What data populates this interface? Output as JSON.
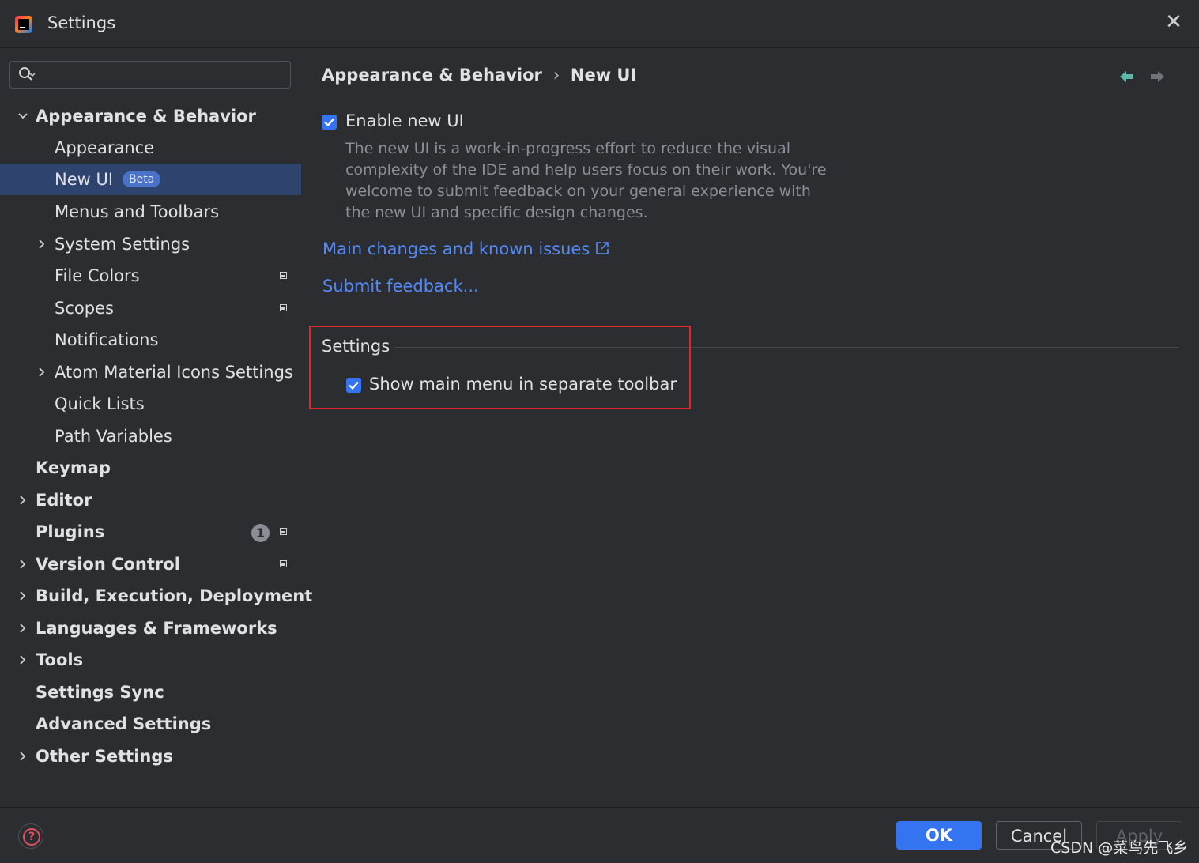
{
  "window": {
    "title": "Settings"
  },
  "search": {
    "placeholder": "",
    "value": ""
  },
  "sidebar": {
    "items": [
      {
        "label": "Appearance & Behavior"
      },
      {
        "label": "Appearance"
      },
      {
        "label": "New UI",
        "badge": "Beta"
      },
      {
        "label": "Menus and Toolbars"
      },
      {
        "label": "System Settings"
      },
      {
        "label": "File Colors"
      },
      {
        "label": "Scopes"
      },
      {
        "label": "Notifications"
      },
      {
        "label": "Atom Material Icons Settings"
      },
      {
        "label": "Quick Lists"
      },
      {
        "label": "Path Variables"
      },
      {
        "label": "Keymap"
      },
      {
        "label": "Editor"
      },
      {
        "label": "Plugins",
        "count": "1"
      },
      {
        "label": "Version Control"
      },
      {
        "label": "Build, Execution, Deployment"
      },
      {
        "label": "Languages & Frameworks"
      },
      {
        "label": "Tools"
      },
      {
        "label": "Settings Sync"
      },
      {
        "label": "Advanced Settings"
      },
      {
        "label": "Other Settings"
      }
    ]
  },
  "content": {
    "breadcrumb": [
      "Appearance & Behavior",
      "New UI"
    ],
    "breadcrumb_separator": "›",
    "enable_new_ui": {
      "label": "Enable new UI",
      "checked": true,
      "description": "The new UI is a work-in-progress effort to reduce the visual complexity of the IDE and help users focus on their work. You're welcome to submit feedback on your general experience with the new UI and specific design changes."
    },
    "link_changes": "Main changes and known issues",
    "link_feedback": "Submit feedback...",
    "settings_section": {
      "title": "Settings",
      "show_main_menu": {
        "label": "Show main menu in separate toolbar",
        "checked": true
      }
    }
  },
  "footer": {
    "ok": "OK",
    "cancel": "Cancel",
    "apply": "Apply",
    "watermark": "CSDN @菜鸟先飞乡"
  },
  "colors": {
    "background": "#2b2d30",
    "selection": "#2e436e",
    "accent": "#3574f0",
    "link": "#548af7",
    "highlight_border": "#e3262c"
  },
  "icons": [
    "app-logo-icon",
    "close-icon",
    "search-icon",
    "chevron-down-icon",
    "chevron-right-icon",
    "project-level-icon",
    "back-arrow-icon",
    "forward-arrow-icon",
    "external-link-icon",
    "checkmark-icon",
    "help-icon"
  ]
}
